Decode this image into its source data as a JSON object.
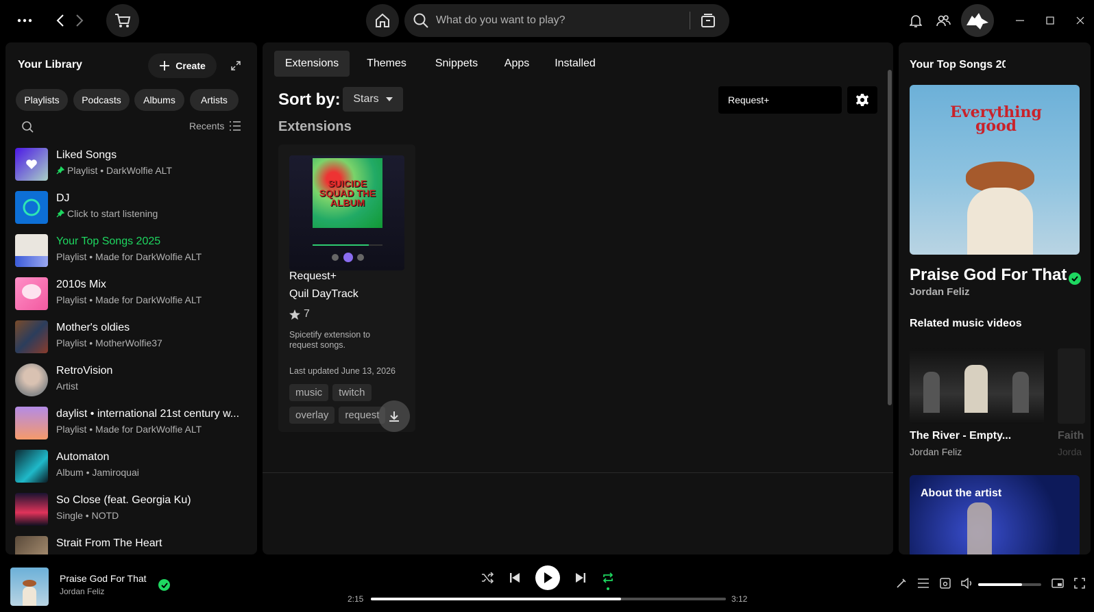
{
  "topbar": {
    "search_placeholder": "What do you want to play?"
  },
  "library": {
    "title": "Your Library",
    "create_label": "Create",
    "filters": [
      "Playlists",
      "Podcasts",
      "Albums",
      "Artists"
    ],
    "sort_label": "Recents",
    "items": [
      {
        "name": "Liked Songs",
        "subtitle": "Playlist • DarkWolfie ALT",
        "pinned": true
      },
      {
        "name": "DJ",
        "subtitle": "Click to start listening",
        "pinned": true
      },
      {
        "name": "Your Top Songs 2025",
        "subtitle": "Playlist • Made for DarkWolfie ALT",
        "active": true
      },
      {
        "name": "2010s Mix",
        "subtitle": "Playlist • Made for DarkWolfie ALT"
      },
      {
        "name": "Mother's oldies",
        "subtitle": "Playlist • MotherWolfie37"
      },
      {
        "name": "RetroVision",
        "subtitle": "Artist"
      },
      {
        "name": "daylist • international 21st century w...",
        "subtitle": "Playlist • Made for DarkWolfie ALT"
      },
      {
        "name": "Automaton",
        "subtitle": "Album • Jamiroquai"
      },
      {
        "name": "So Close (feat. Georgia Ku)",
        "subtitle": "Single • NOTD"
      },
      {
        "name": "Strait From The Heart",
        "subtitle": ""
      }
    ]
  },
  "main": {
    "tabs": [
      "Extensions",
      "Themes",
      "Snippets",
      "Apps",
      "Installed"
    ],
    "active_tab": "Extensions",
    "sort_by_label": "Sort by:",
    "sort_value": "Stars",
    "search_value": "Request+",
    "section_title": "Extensions",
    "card": {
      "title": "Request+",
      "author": "Quil DayTrack",
      "stars": "7",
      "description": "Spicetify extension to request songs.",
      "updated": "Last updated June 13, 2026",
      "tags": [
        "music",
        "twitch",
        "overlay",
        "request"
      ],
      "image_lettering": "SUICIDE SQUAD THE ALBUM"
    }
  },
  "right_panel": {
    "header": "Your Top Songs 20",
    "album_art_lettering": "Everything good",
    "song_title": "Praise God For That",
    "artist": "Jordan Feliz",
    "related_heading": "Related music videos",
    "videos": [
      {
        "title": "The River - Empty...",
        "artist": "Jordan Feliz"
      },
      {
        "title": "Faith",
        "artist": "Jorda"
      }
    ],
    "about_heading": "About the artist"
  },
  "player": {
    "title": "Praise God For That",
    "artist": "Jordan Feliz",
    "elapsed": "2:15",
    "duration": "3:12",
    "progress": 0.704,
    "volume": 0.7
  },
  "colors": {
    "accent": "#1ed760",
    "background": "#000000",
    "panel": "#121212",
    "muted_text": "#b3b3b3"
  }
}
